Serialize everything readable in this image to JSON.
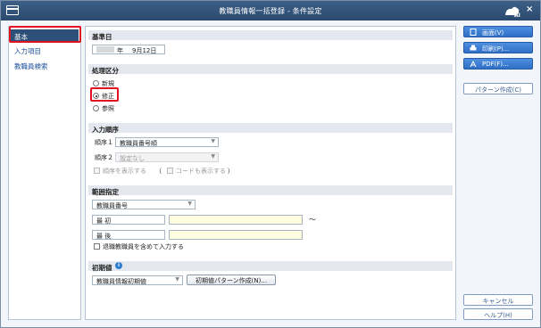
{
  "window": {
    "title": "教職員情報一括登録 - 条件設定",
    "close_glyph": "×"
  },
  "sidebar": {
    "items": [
      {
        "label": "基本",
        "active": true
      },
      {
        "label": "入力項目",
        "active": false
      },
      {
        "label": "教職員検索",
        "active": false
      }
    ]
  },
  "base_date": {
    "header": "基準日",
    "year_suffix": "年",
    "date_text": "9月12日"
  },
  "process": {
    "header": "処理区分",
    "options": [
      {
        "label": "新規",
        "selected": false
      },
      {
        "label": "修正",
        "selected": true
      },
      {
        "label": "参照",
        "selected": false
      }
    ]
  },
  "input_order": {
    "header": "入力順序",
    "order1_label": "順序１",
    "order1_value": "教職員番号順",
    "order2_label": "順序２",
    "order2_value": "設定なし",
    "show_order_label": "順序を表示する",
    "paren_open": "（",
    "show_code_label": "コードも表示する",
    "paren_close": "）"
  },
  "range": {
    "header": "範囲指定",
    "key_value": "教職員番号",
    "first_label": "最 初",
    "last_label": "最 後",
    "tilde": "〜",
    "include_retired_label": "退職教職員を含めて入力する"
  },
  "initial": {
    "header": "初期値",
    "info_icon": "i",
    "select_value": "教職員情報初期値",
    "pattern_button": "初期値パターン作成(N)..."
  },
  "right_panel": {
    "screen_button": "画面(V)",
    "print_button": "印刷(P)...",
    "pdf_button": "PDF(F)...",
    "pattern_button": "パターン作成(C)",
    "cancel_button": "キャンセル",
    "help_button": "ヘルプ(H)"
  },
  "colors": {
    "titlebar": "#2f5079",
    "accent_blue": "#2f6fc6",
    "highlight_red": "#e0141e",
    "field_yellow": "#fffde0"
  }
}
